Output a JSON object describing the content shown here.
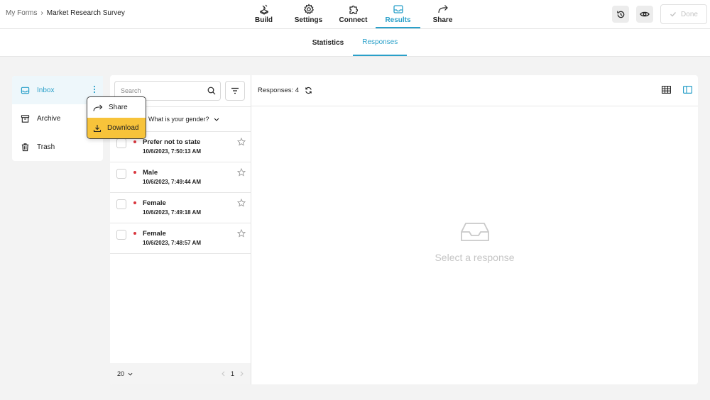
{
  "breadcrumb": {
    "root": "My Forms",
    "separator": "›",
    "current": "Market Research Survey"
  },
  "topnav": [
    {
      "id": "build",
      "label": "Build",
      "icon": "build-icon"
    },
    {
      "id": "settings",
      "label": "Settings",
      "icon": "gear-icon"
    },
    {
      "id": "connect",
      "label": "Connect",
      "icon": "puzzle-icon"
    },
    {
      "id": "results",
      "label": "Results",
      "icon": "inbox-icon",
      "active": true
    },
    {
      "id": "share",
      "label": "Share",
      "icon": "share-arrow-icon"
    }
  ],
  "actions": {
    "done_label": "Done"
  },
  "subtabs": [
    {
      "label": "Statistics",
      "active": false
    },
    {
      "label": "Responses",
      "active": true
    }
  ],
  "folders": [
    {
      "label": "Inbox",
      "icon": "inbox-icon",
      "active": true
    },
    {
      "label": "Archive",
      "icon": "archive-icon"
    },
    {
      "label": "Trash",
      "icon": "trash-icon"
    }
  ],
  "context_menu": [
    {
      "label": "Share",
      "icon": "share-arrow-icon"
    },
    {
      "label": "Download",
      "icon": "download-icon",
      "highlighted": true
    }
  ],
  "list": {
    "search_placeholder": "Search",
    "column_label": "What is your gender?",
    "rows": [
      {
        "title": "Prefer not to state",
        "date": "10/6/2023, 7:50:13 AM"
      },
      {
        "title": "Male",
        "date": "10/6/2023, 7:49:44 AM"
      },
      {
        "title": "Female",
        "date": "10/6/2023, 7:49:18 AM"
      },
      {
        "title": "Female",
        "date": "10/6/2023, 7:48:57 AM"
      }
    ],
    "page_size": "20",
    "page_number": "1"
  },
  "detail": {
    "responses_label": "Responses: 4",
    "empty_text": "Select a response"
  },
  "colors": {
    "accent": "#2aa0c9",
    "highlight": "#f7c33a",
    "unread_dot": "#d9363e"
  }
}
